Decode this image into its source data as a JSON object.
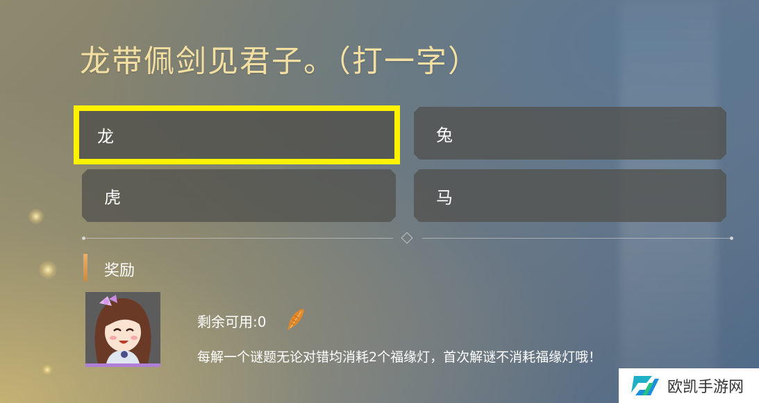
{
  "puzzle": {
    "question": "龙带佩剑见君子。（打一字）"
  },
  "options": [
    {
      "label": "龙",
      "selected": true
    },
    {
      "label": "兔",
      "selected": false
    },
    {
      "label": "虎",
      "selected": false
    },
    {
      "label": "马",
      "selected": false
    }
  ],
  "reward": {
    "section_title": "奖励",
    "remaining": "剩余可用:0",
    "item_icon": "feather-icon",
    "avatar_icon": "character-avatar-icon",
    "description": "每解一个谜题无论对错均消耗2个福缘灯，首次解谜不消耗福缘灯哦！"
  },
  "watermark": {
    "text": "欧凯手游网",
    "logo_icon": "ok-logo-icon"
  },
  "colors": {
    "highlight": "#fff200",
    "question_text": "#f3dfa2",
    "reward_bar": "#d99a55"
  }
}
